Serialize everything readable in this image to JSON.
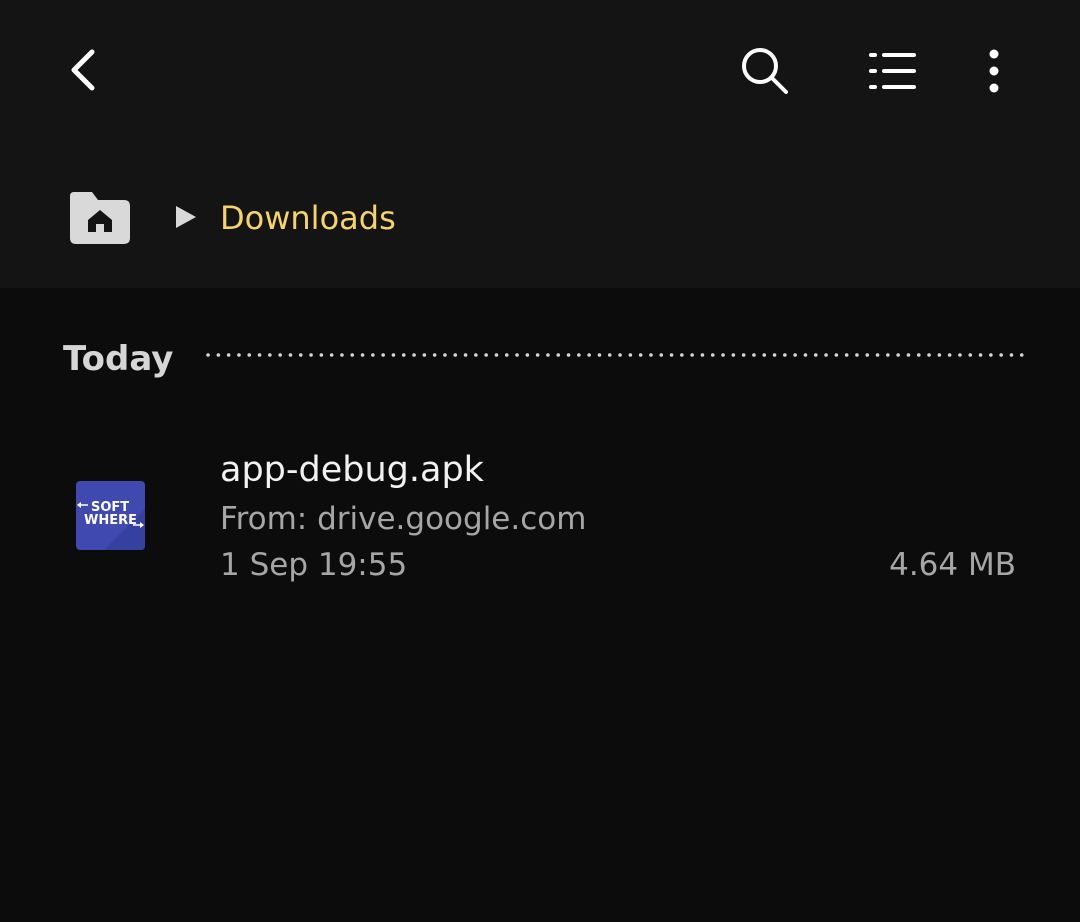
{
  "toolbar": {
    "back_icon": "chevron-left-icon",
    "search_icon": "search-icon",
    "list_view_icon": "list-view-icon",
    "more_icon": "more-vertical-icon"
  },
  "breadcrumb": {
    "home_icon": "home-folder-icon",
    "separator_icon": "triangle-right-icon",
    "current": "Downloads"
  },
  "section": {
    "title": "Today"
  },
  "files": [
    {
      "name": "app-debug.apk",
      "source": "From: drive.google.com",
      "date": "1 Sep 19:55",
      "size": "4.64 MB",
      "thumbnail_text_top": "SOFT",
      "thumbnail_text_bottom": "WHERE"
    }
  ],
  "colors": {
    "header_bg": "#141414",
    "body_bg": "#0c0c0c",
    "accent": "#f5d46a",
    "primary_text": "#f2f2f2",
    "secondary_text": "#a6a6a6",
    "thumbnail_bg": "#3f49b0"
  }
}
